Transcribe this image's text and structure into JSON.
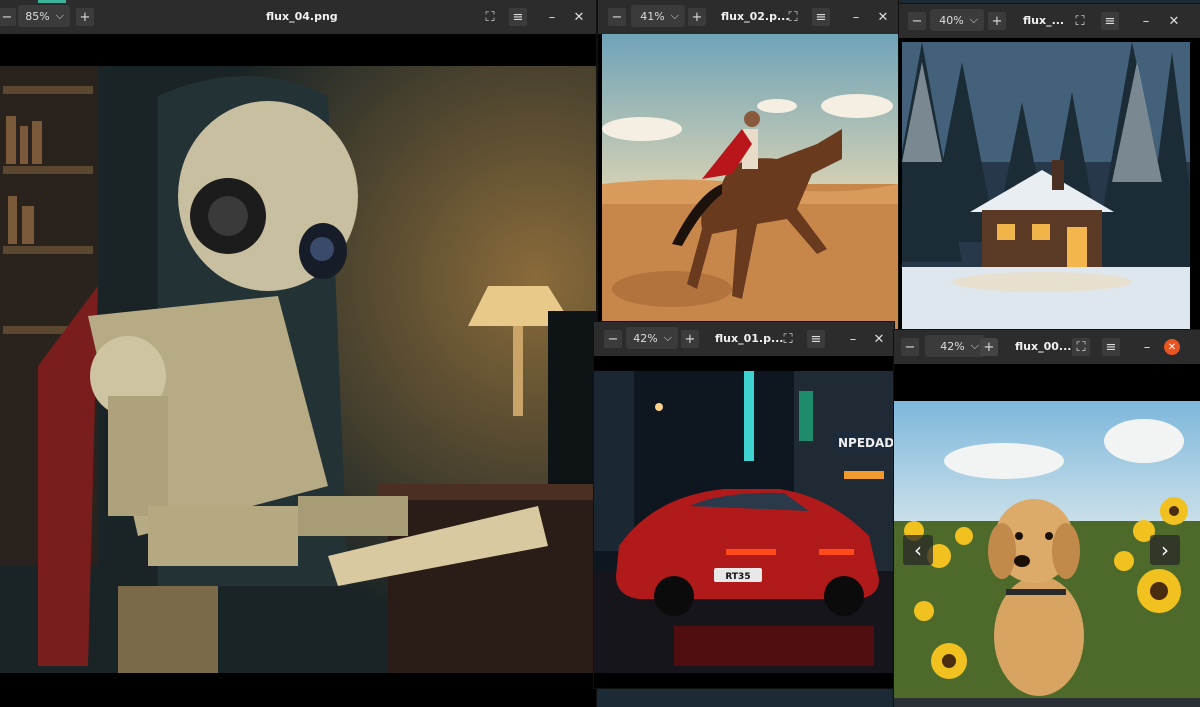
{
  "windows": [
    {
      "id": "w4",
      "title": "flux_04.png",
      "zoom": "85%",
      "image": "robot-reading-book"
    },
    {
      "id": "w2",
      "title": "flux_02.p...",
      "zoom": "41%",
      "image": "rider-on-horse-desert"
    },
    {
      "id": "w3",
      "title": "flux_...",
      "zoom": "40%",
      "image": "snowy-cabin-forest"
    },
    {
      "id": "w1",
      "title": "flux_01.p...",
      "zoom": "42%",
      "image": "red-sports-car-city-night"
    },
    {
      "id": "w0",
      "title": "flux_00....",
      "zoom": "42%",
      "image": "golden-retriever-sunflowers"
    }
  ],
  "car_plate": "RT35",
  "sign_text": "NPEDAD",
  "icons": {
    "zoom_out": "minus-icon",
    "zoom_in": "plus-icon",
    "fullscreen": "fullscreen-icon",
    "menu": "hamburger-menu-icon",
    "minimize": "minimize-icon",
    "close": "close-icon",
    "prev": "chevron-left-icon",
    "next": "chevron-right-icon"
  },
  "colors": {
    "titlebar": "#2c2c2c",
    "close_active": "#e95420",
    "accent": "#3db49a"
  }
}
